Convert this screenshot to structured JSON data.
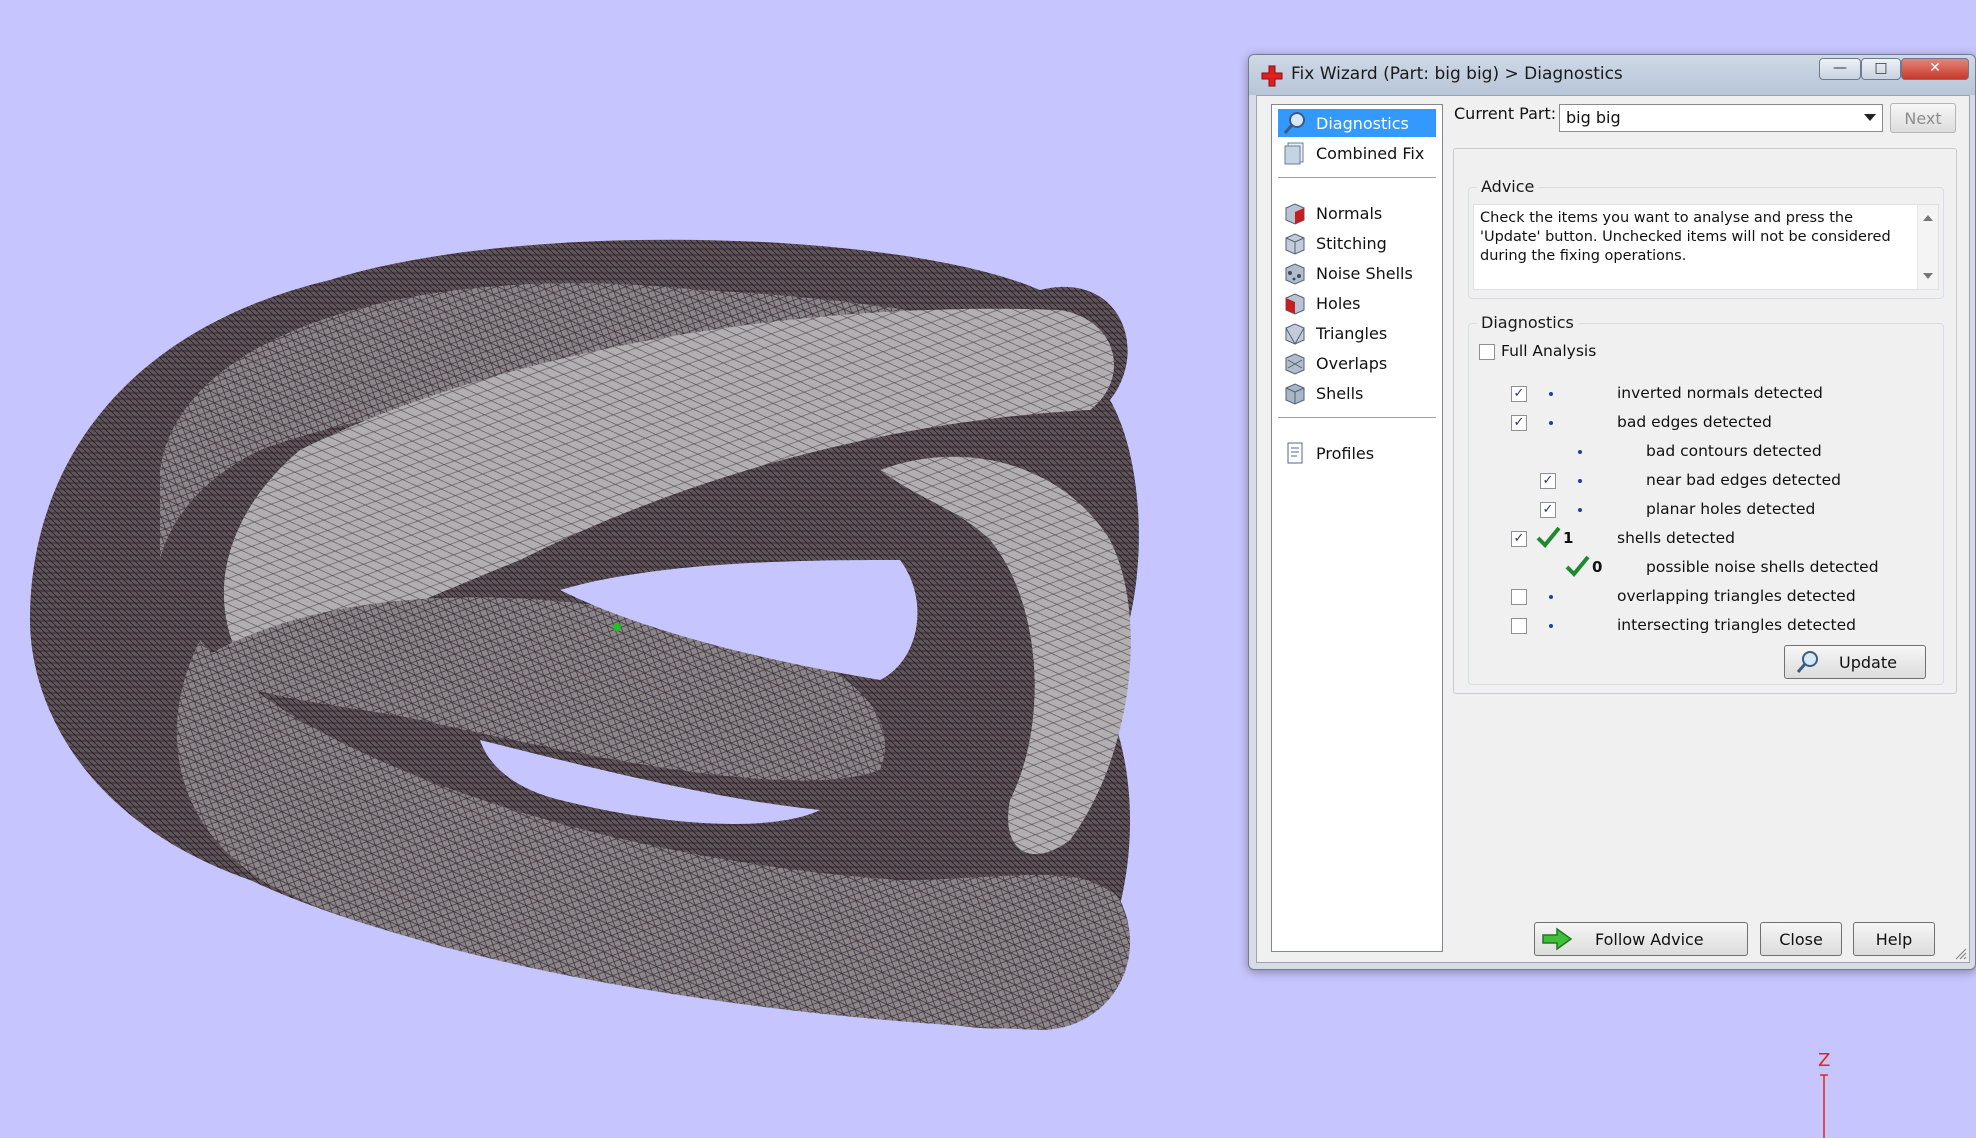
{
  "viewport": {
    "axis_label": "Z"
  },
  "dialog": {
    "title": "Fix Wizard (Part: big big) > Diagnostics",
    "window_buttons": {
      "minimize": "—",
      "maximize": "□",
      "close": "✕"
    },
    "nav": {
      "items": [
        {
          "label": "Diagnostics",
          "icon": "magnifier-icon",
          "selected": true
        },
        {
          "label": "Combined Fix",
          "icon": "pages-icon"
        },
        {
          "label": "Normals",
          "icon": "red-cube-icon"
        },
        {
          "label": "Stitching",
          "icon": "stitch-cube-icon"
        },
        {
          "label": "Noise Shells",
          "icon": "noise-cube-icon"
        },
        {
          "label": "Holes",
          "icon": "holes-cube-icon"
        },
        {
          "label": "Triangles",
          "icon": "triangle-cube-icon"
        },
        {
          "label": "Overlaps",
          "icon": "overlap-cube-icon"
        },
        {
          "label": "Shells",
          "icon": "shell-cube-icon"
        },
        {
          "label": "Profiles",
          "icon": "document-icon"
        }
      ]
    },
    "current_part": {
      "label": "Current Part:",
      "value": "big big"
    },
    "next_button": "Next",
    "advice": {
      "title": "Advice",
      "text": "Check the items you want to analyse and press the 'Update' button. Unchecked items will not be considered during the fixing operations."
    },
    "diagnostics": {
      "title": "Diagnostics",
      "full_analysis": {
        "label": "Full Analysis",
        "checked": false
      },
      "rows": [
        {
          "label": "inverted normals detected",
          "checked": true,
          "indent": 0
        },
        {
          "label": "bad edges detected",
          "checked": true,
          "indent": 0
        },
        {
          "label": "bad contours detected",
          "checked": null,
          "indent": 1
        },
        {
          "label": "near bad edges detected",
          "checked": true,
          "indent": 1
        },
        {
          "label": "planar holes detected",
          "checked": true,
          "indent": 1
        },
        {
          "label": "shells detected",
          "checked": true,
          "indent": 0,
          "result": "1",
          "ok": true
        },
        {
          "label": "possible noise shells detected",
          "checked": null,
          "indent": 1,
          "result": "0",
          "ok": true
        },
        {
          "label": "overlapping triangles detected",
          "checked": false,
          "indent": 0
        },
        {
          "label": "intersecting triangles detected",
          "checked": false,
          "indent": 0
        }
      ]
    },
    "update_button": "Update",
    "follow_advice_button": "Follow Advice",
    "close_button": "Close",
    "help_button": "Help"
  }
}
